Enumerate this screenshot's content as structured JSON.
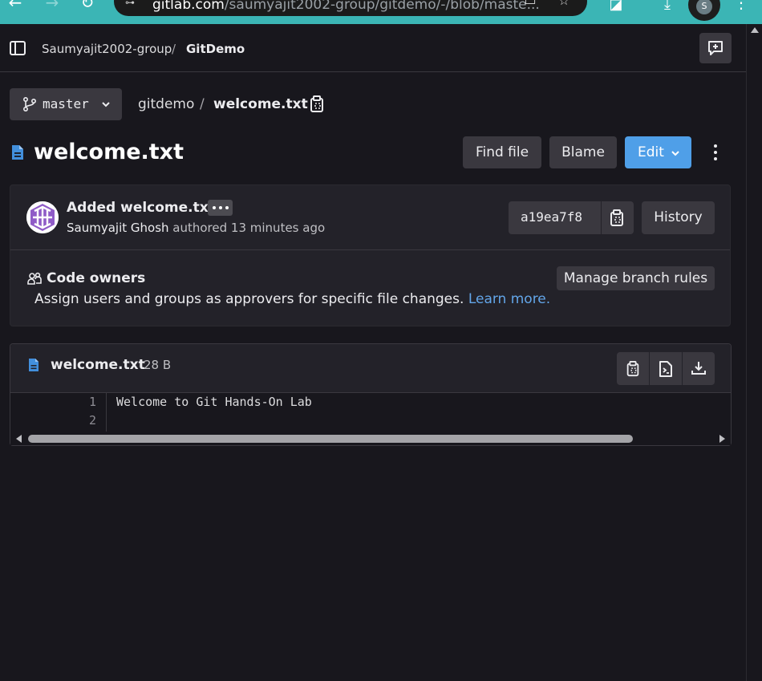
{
  "browser": {
    "url_host": "gitlab.com",
    "url_path": "/saumyajit2002-group/gitdemo/-/blob/maste...",
    "profile_initial": "S"
  },
  "topbar": {
    "group": "Saumyajit2002-group",
    "separator": "/",
    "project": "GitDemo"
  },
  "path_bar": {
    "branch": "master",
    "repo": "gitdemo",
    "separator": "/",
    "file": "welcome.txt"
  },
  "header": {
    "title": "welcome.txt",
    "find_file": "Find file",
    "blame": "Blame",
    "edit": "Edit"
  },
  "commit": {
    "title": "Added welcome.txt",
    "author": "Saumyajit Ghosh",
    "authored_text": "authored 13 minutes ago",
    "sha": "a19ea7f8",
    "history": "History"
  },
  "code_owners": {
    "title": "Code owners",
    "description": "Assign users and groups as approvers for specific file changes.",
    "learn_more": "Learn more.",
    "manage_button": "Manage branch rules"
  },
  "viewer": {
    "file_name": "welcome.txt",
    "file_size": "28 B",
    "line_numbers": [
      "1",
      "2"
    ],
    "lines": [
      "Welcome to Git Hands-On Lab",
      ""
    ]
  },
  "colors": {
    "background": "#18171d",
    "card": "#232229",
    "button": "#3a383f",
    "primary": "#4f9fe8",
    "link": "#63a6e9",
    "browser_bar": "#3bb5b5"
  }
}
